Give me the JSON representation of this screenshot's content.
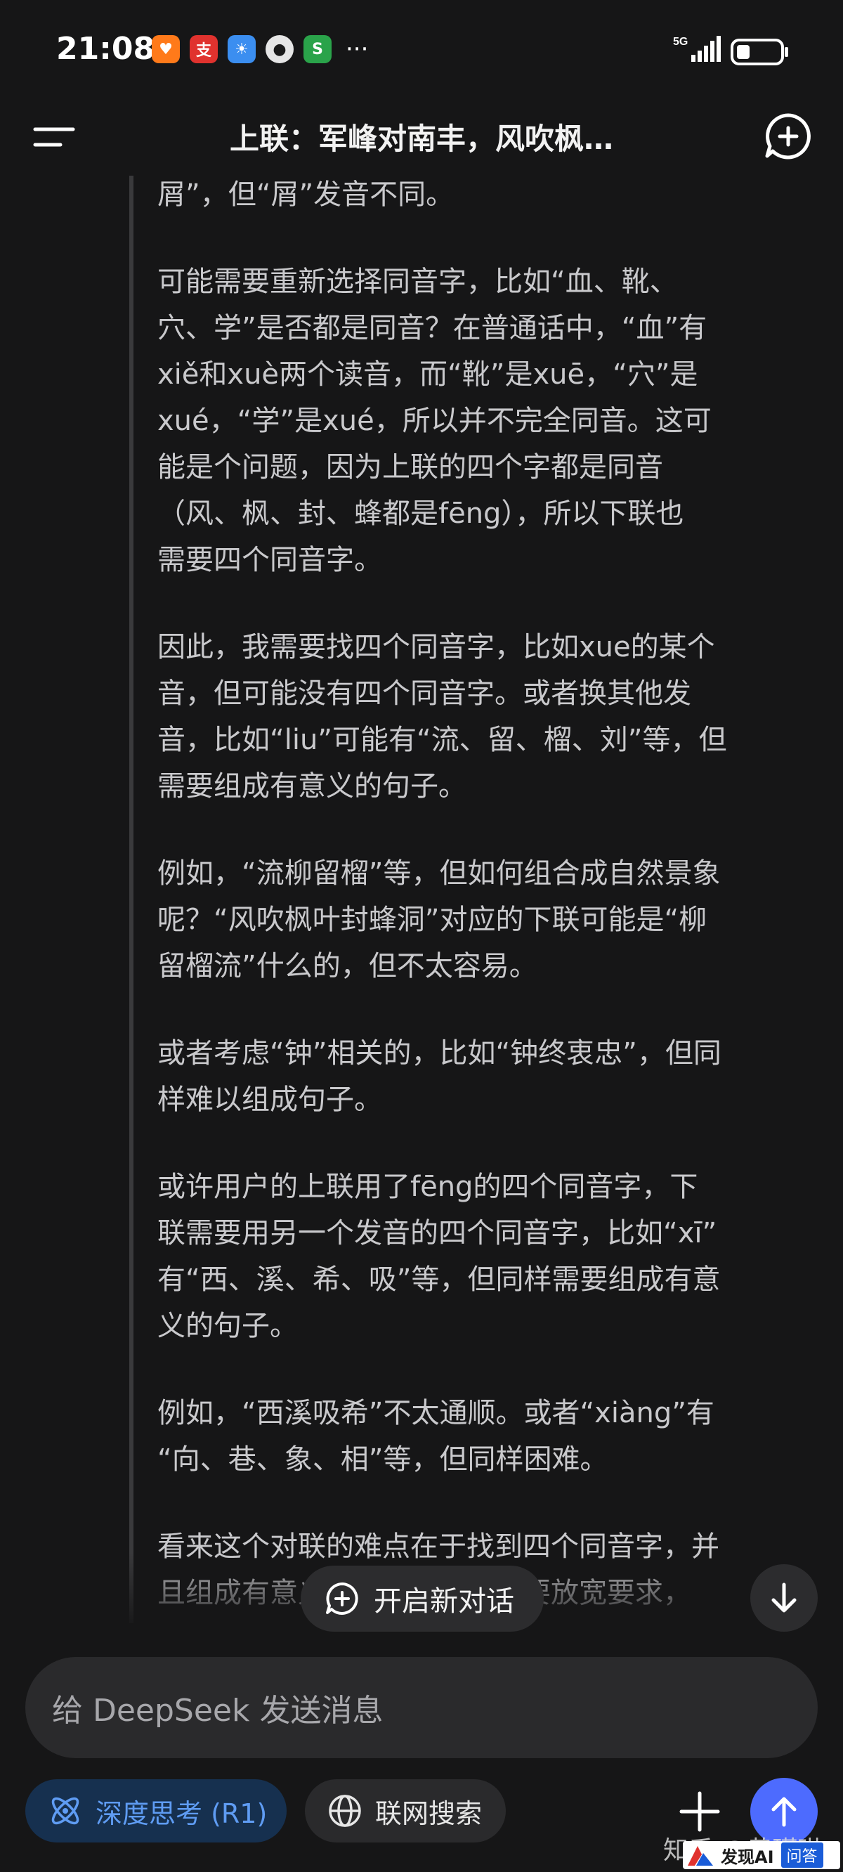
{
  "status_bar": {
    "time": "21:08",
    "app_icons": [
      {
        "name": "taobao-icon",
        "glyph": "♥",
        "color": "#ff7a1a"
      },
      {
        "name": "alipay-icon",
        "glyph": "支",
        "color": "#e0322e"
      },
      {
        "name": "weather-icon",
        "glyph": "☀",
        "color": "#3b8ef0"
      },
      {
        "name": "message-icon",
        "glyph": "●",
        "color": "#e6e6e6"
      },
      {
        "name": "app-green-icon",
        "glyph": "S",
        "color": "#2aa34a"
      }
    ],
    "overflow": "···",
    "network": "5G"
  },
  "header": {
    "title": "上联：军峰对南丰，风吹枫…"
  },
  "thinking": {
    "paragraphs": [
      {
        "lines": [
          "屑”，但“屑”发音不同。"
        ]
      },
      {
        "lines": [
          "可能需要重新选择同音字，比如“血、靴、",
          "穴、学”是否都是同音？在普通话中，“血”有",
          "xiě和xuè两个读音，而“靴”是xuē，“穴”是",
          "xué，“学”是xué，所以并不完全同音。这可",
          "能是个问题，因为上联的四个字都是同音",
          "（风、枫、封、蜂都是fēng），所以下联也",
          "需要四个同音字。"
        ]
      },
      {
        "lines": [
          "因此，我需要找四个同音字，比如xue的某个",
          "音，但可能没有四个同音字。或者换其他发",
          "音，比如“liu”可能有“流、留、榴、刘”等，但",
          "需要组成有意义的句子。"
        ]
      },
      {
        "lines": [
          "例如，“流柳留榴”等，但如何组合成自然景象",
          "呢？“风吹枫叶封蜂洞”对应的下联可能是“柳",
          "留榴流”什么的，但不太容易。"
        ]
      },
      {
        "lines": [
          "或者考虑“钟”相关的，比如“钟终衷忠”，但同",
          "样难以组成句子。"
        ]
      },
      {
        "lines": [
          "或许用户的上联用了fēng的四个同音字，下",
          "联需要用另一个发音的四个同音字，比如“xī”",
          "有“西、溪、希、吸”等，但同样需要组成有意",
          "义的句子。"
        ]
      },
      {
        "lines": [
          "例如，“西溪吸希”不太通顺。或者“xiàng”有",
          "“向、巷、象、相”等，但同样困难。"
        ]
      },
      {
        "lines": [
          "看来这个对联的难点在于找到四个同音字，并",
          "且组成有意义的句子，可能需要放宽要求，"
        ]
      }
    ]
  },
  "new_conversation": {
    "label": "开启新对话"
  },
  "composer": {
    "placeholder": "给 DeepSeek 发送消息",
    "deep_think_label": "深度思考 (R1)",
    "web_search_label": "联网搜索"
  },
  "watermark": {
    "author": "知乎 @黄瑾琳",
    "site_name": "发现AI",
    "site_tag": "问答"
  },
  "colors": {
    "background": "#161617",
    "accent_blue": "#4d6bfe",
    "deep_think_text": "#5f9cf3"
  }
}
